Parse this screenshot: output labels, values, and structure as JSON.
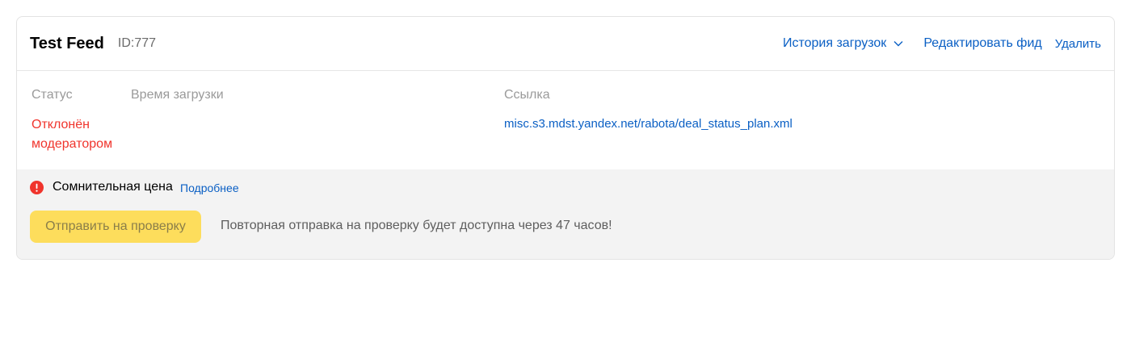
{
  "feed": {
    "title": "Test Feed",
    "id_label": "ID:777"
  },
  "header_actions": {
    "history_label": "История загрузок",
    "edit_label": "Редактировать фид",
    "delete_label": "Удалить"
  },
  "info": {
    "status_header": "Статус",
    "time_header": "Время загрузки",
    "link_header": "Ссылка",
    "status_line1": "Отклонён",
    "status_line2": "модератором",
    "upload_time": "",
    "url": "misc.s3.mdst.yandex.net/rabota/deal_status_plan.xml"
  },
  "warning": {
    "title": "Сомнительная цена",
    "more_label": "Подробнее",
    "submit_label": "Отправить на проверку",
    "note": "Повторная отправка на проверку будет доступна через 47 часов!"
  },
  "icons": {
    "history_chevron": "chevron-down-icon",
    "warning": "alert-circle-icon"
  },
  "colors": {
    "link": "#0a5fc4",
    "error": "#f0342c",
    "button": "#fddd5c",
    "warning_bg": "#f3f3f3"
  }
}
